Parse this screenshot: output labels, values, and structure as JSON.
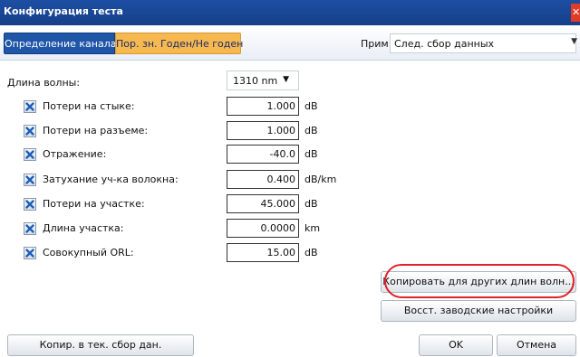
{
  "window": {
    "title": "Конфигурация теста",
    "close_glyph": "✕"
  },
  "tabs": [
    {
      "label": "Определение канала",
      "active": true
    },
    {
      "label": "Пор. зн. Годен/Не годен",
      "active": false
    }
  ],
  "apply_to": {
    "label": "Прим. к:",
    "value": "След. сбор данных"
  },
  "wavelength": {
    "label": "Длина волны:",
    "value": "1310 nm"
  },
  "thresholds": [
    {
      "label": "Потери на стыке:",
      "value": "1.000",
      "unit": "dB",
      "checked": true
    },
    {
      "label": "Потери на разъеме:",
      "value": "1.000",
      "unit": "dB",
      "checked": true
    },
    {
      "label": "Отражение:",
      "value": "-40.0",
      "unit": "dB",
      "checked": true
    },
    {
      "label": "Затухание уч-ка волокна:",
      "value": "0.400",
      "unit": "dB/km",
      "checked": true
    },
    {
      "label": "Потери на участке:",
      "value": "45.000",
      "unit": "dB",
      "checked": true
    },
    {
      "label": "Длина участка:",
      "value": "0.0000",
      "unit": "km",
      "checked": true
    },
    {
      "label": "Совокупный ORL:",
      "value": "15.00",
      "unit": "dB",
      "checked": true
    }
  ],
  "buttons": {
    "copy_other_wavelengths": "Копировать для других длин волн...",
    "restore_defaults": "Восст. заводские настройки",
    "copy_current": "Копир. в тек. сбор дан.",
    "ok": "OK",
    "cancel": "Отмена"
  },
  "colors": {
    "title_bar": "#1d4ea3",
    "active_tab": "#1f56a8",
    "inactive_tab": "#f6b84f",
    "highlight_ring": "#e0222a"
  }
}
